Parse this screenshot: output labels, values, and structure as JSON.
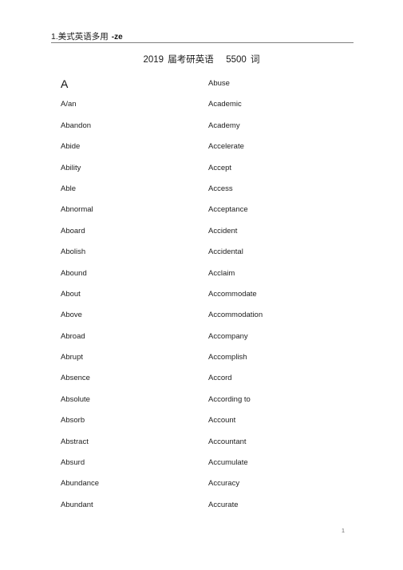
{
  "header": {
    "chinese_text": "1.美式英语多用",
    "suffix": "-ze",
    "rule_color": "#808080"
  },
  "title": {
    "year": "2019",
    "label_cn": "届考研英语",
    "count": "5500",
    "unit_cn": "词",
    "full_text": "2019 届考研英语  5500 词"
  },
  "columns": {
    "left": {
      "section_letter": "A",
      "words": [
        "A/an",
        "Abandon",
        "Abide",
        "Ability",
        "Able",
        "Abnormal",
        "Aboard",
        "Abolish",
        "Abound",
        "About",
        "Above",
        "Abroad",
        "Abrupt",
        "Absence",
        "Absolute",
        "Absorb",
        "Abstract",
        "Absurd",
        "Abundance",
        "Abundant"
      ]
    },
    "right": {
      "words": [
        "Abuse",
        "Academic",
        "Academy",
        "Accelerate",
        "Accept",
        "Access",
        "Acceptance",
        "Accident",
        "Accidental",
        "Acclaim",
        "Accommodate",
        "Accommodation",
        "Accompany",
        "Accomplish",
        "Accord",
        "According to",
        "Account",
        "Accountant",
        "Accumulate",
        "Accuracy",
        "Accurate"
      ]
    }
  },
  "footer": {
    "page_number": "1"
  },
  "colors": {
    "text": "#1f1f1f",
    "heading": "#111111",
    "rule": "#808080",
    "page_number": "#6b6b6b",
    "background": "#ffffff"
  }
}
